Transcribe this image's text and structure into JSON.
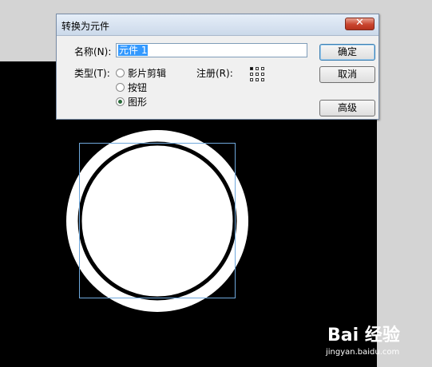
{
  "dialog": {
    "title": "转换为元件",
    "close_symbol": "✕",
    "name_label": "名称(N):",
    "name_value": "元件 1",
    "type_label": "类型(T):",
    "types": [
      {
        "label": "影片剪辑",
        "selected": false
      },
      {
        "label": "按钮",
        "selected": false
      },
      {
        "label": "图形",
        "selected": true
      }
    ],
    "registration_label": "注册(R):",
    "buttons": {
      "ok": "确定",
      "cancel": "取消",
      "advanced": "高级"
    }
  },
  "watermark": {
    "main": "Bai 经验",
    "sub": "jingyan.baidu.com"
  },
  "colors": {
    "stage": "#000000",
    "selection_box": "#6fa8dc",
    "dialog_bg": "#f0f0f0",
    "close_button": "#c9442e"
  }
}
